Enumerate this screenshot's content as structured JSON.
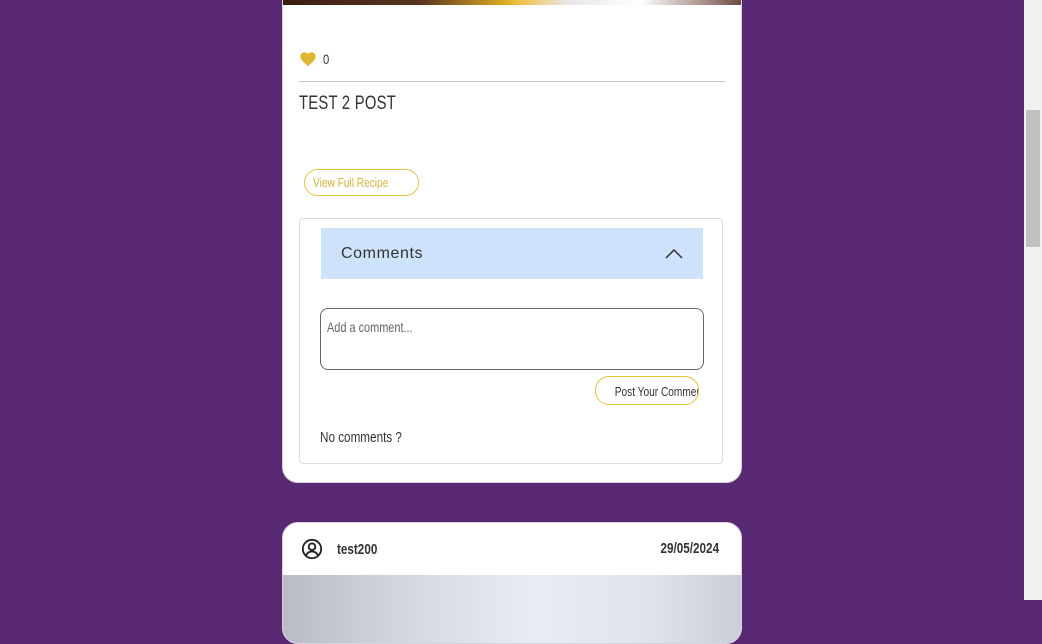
{
  "post1": {
    "like_count": "0",
    "title": "TEST 2 POST",
    "view_recipe_label": "View Full Recipe",
    "comments": {
      "header": "Comments",
      "input_placeholder": "Add a comment...",
      "post_button_label": "Post Your Comment",
      "empty_text": "No comments ?"
    }
  },
  "post2": {
    "author": "test200",
    "date": "29/05/2024"
  },
  "colors": {
    "page_background": "#582873",
    "accent_gold": "#e0b530",
    "comments_header_bg": "#cfe2fb"
  },
  "icons": [
    "heart-icon",
    "chevron-up-icon",
    "user-circle-icon"
  ]
}
